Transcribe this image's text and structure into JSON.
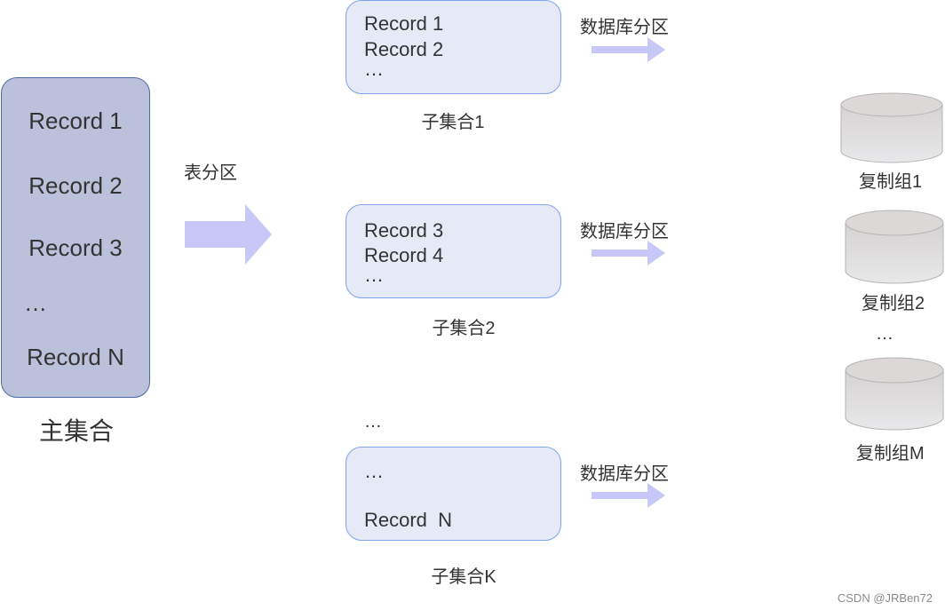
{
  "master": {
    "records": [
      "Record 1",
      "Record 2",
      "Record 3",
      "…",
      "Record N"
    ],
    "label": "主集合"
  },
  "table_partition": {
    "label": "表分区"
  },
  "subsets": [
    {
      "lines": [
        "Record 1",
        "Record 2",
        "…"
      ],
      "label": "子集合1",
      "arrow_label": "数据库分区"
    },
    {
      "lines": [
        "Record 3",
        "Record 4",
        "…"
      ],
      "label": "子集合2",
      "arrow_label": "数据库分区"
    },
    {
      "lines": [
        "…",
        "",
        "Record  N"
      ],
      "label": "子集合K",
      "arrow_label": "数据库分区"
    }
  ],
  "between_subsets_ellipsis": "…",
  "replica_groups": [
    {
      "label": "复制组1"
    },
    {
      "label": "复制组2"
    },
    {
      "label": "复制组M"
    }
  ],
  "replica_ellipsis": "…",
  "watermark": "CSDN @JRBen72",
  "colors": {
    "master_fill": "#bcc1db",
    "master_border": "#4d6aa6",
    "subset_fill": "#e6eaf6",
    "subset_border": "#7fa3ec",
    "arrow_fill": "#c8c8f8",
    "db_fill": "#dcdada"
  }
}
